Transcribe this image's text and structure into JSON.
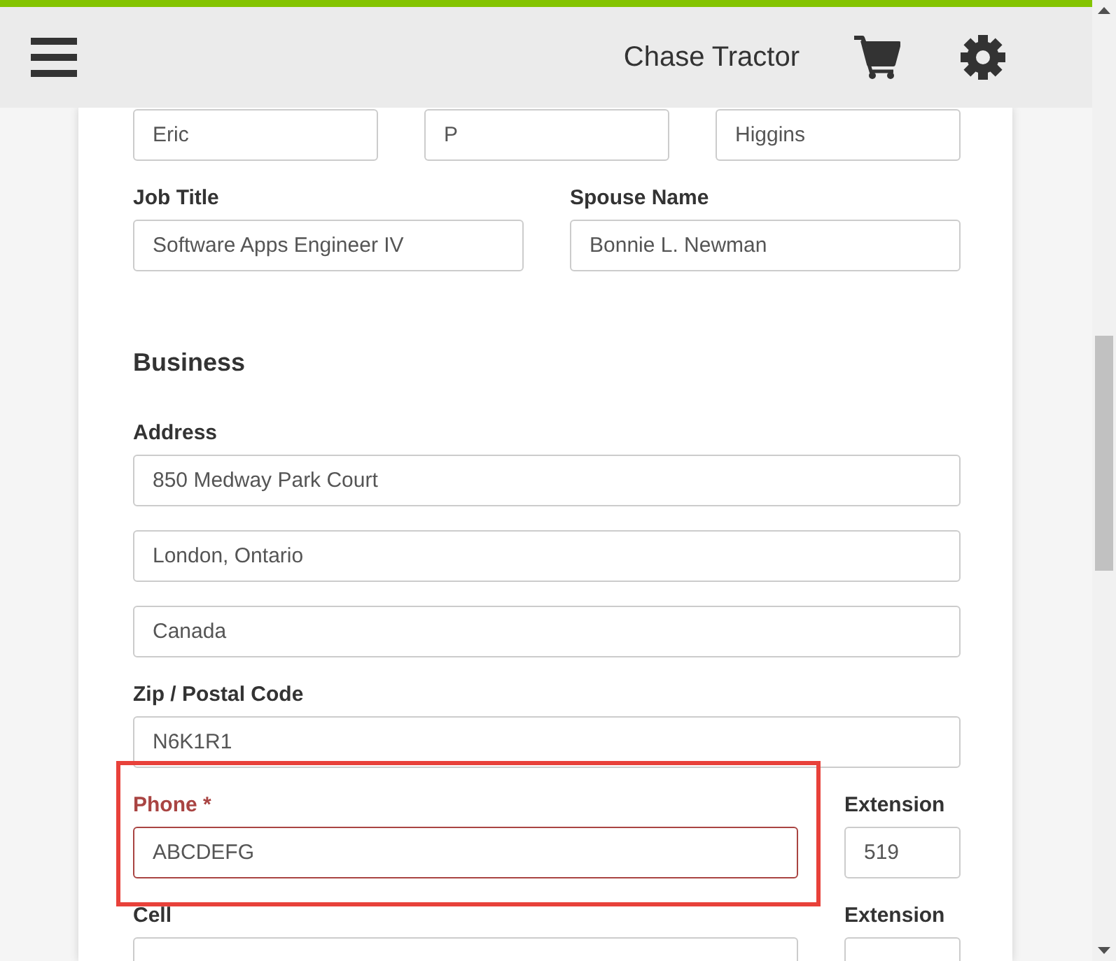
{
  "header": {
    "title": "Chase Tractor"
  },
  "form": {
    "rows": [
      {
        "kind": "fields",
        "fields": [
          {
            "value": "Eric",
            "invalid": false,
            "highlighted": false
          },
          {
            "value": "P",
            "invalid": false,
            "highlighted": false
          },
          {
            "value": "Higgins",
            "invalid": false,
            "highlighted": false
          }
        ]
      },
      {
        "kind": "fields",
        "fields": [
          {
            "label": "Job Title",
            "value": "Software Apps Engineer IV",
            "invalid": false,
            "highlighted": false
          },
          {
            "label": "Spouse Name",
            "value": "Bonnie L. Newman",
            "invalid": false,
            "highlighted": false
          }
        ]
      },
      {
        "kind": "heading",
        "text": "Business"
      },
      {
        "kind": "fields",
        "fields": [
          {
            "label": "Address",
            "value": "850 Medway Park Court",
            "invalid": false,
            "highlighted": false
          }
        ]
      },
      {
        "kind": "fields",
        "fields": [
          {
            "value": "London, Ontario",
            "invalid": false,
            "highlighted": false
          }
        ]
      },
      {
        "kind": "fields",
        "fields": [
          {
            "value": "Canada",
            "invalid": false,
            "highlighted": false
          }
        ]
      },
      {
        "kind": "fields",
        "fields": [
          {
            "label": "Zip / Postal Code",
            "value": "N6K1R1",
            "invalid": false,
            "highlighted": false
          }
        ]
      },
      {
        "kind": "number_with_extension",
        "fields": [
          {
            "label": "Phone *",
            "value": "ABCDEFG",
            "invalid": true,
            "highlighted": true
          },
          {
            "label": "Extension",
            "value": "519",
            "invalid": false,
            "highlighted": false
          }
        ]
      },
      {
        "kind": "number_with_extension",
        "fields": [
          {
            "label": "Cell",
            "invalid": false,
            "highlighted": false
          },
          {
            "label": "Extension",
            "invalid": false,
            "highlighted": false
          }
        ]
      }
    ]
  }
}
